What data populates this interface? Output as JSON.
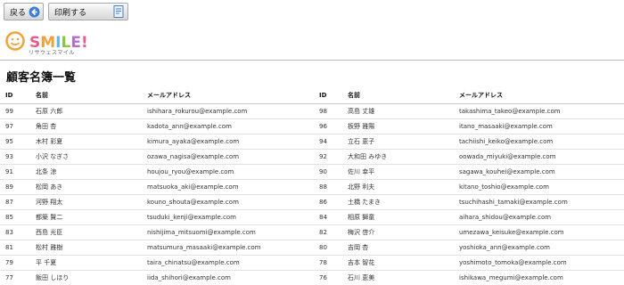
{
  "toolbar": {
    "back_label": "戻る",
    "print_label": "印刷する"
  },
  "logo": {
    "text": "SMILE!",
    "subtitle": "リサウェスマイル",
    "face_color": "#f2a23a",
    "letter_colors": [
      "#e85b8a",
      "#f2a23a",
      "#5bb8e8",
      "#8cc63f",
      "#b36fd1",
      "#e85b8a"
    ]
  },
  "page": {
    "title": "顧客名簿一覧"
  },
  "table": {
    "headers": {
      "id": "ID",
      "name": "名前",
      "email": "メールアドレス"
    },
    "left_rows": [
      {
        "id": "99",
        "name": "石原 六郎",
        "email": "ishihara_rokurou@example.com"
      },
      {
        "id": "97",
        "name": "角田 杏",
        "email": "kadota_ann@example.com"
      },
      {
        "id": "95",
        "name": "木村 彩夏",
        "email": "kimura_ayaka@example.com"
      },
      {
        "id": "93",
        "name": "小沢 なぎさ",
        "email": "ozawa_nagisa@example.com"
      },
      {
        "id": "91",
        "name": "北条 涼",
        "email": "houjou_ryou@example.com"
      },
      {
        "id": "89",
        "name": "松岡 あき",
        "email": "matsuoka_aki@example.com"
      },
      {
        "id": "87",
        "name": "河野 翔太",
        "email": "kouno_shouta@example.com"
      },
      {
        "id": "85",
        "name": "都築 賢二",
        "email": "tsuduki_kenji@example.com"
      },
      {
        "id": "83",
        "name": "西島 光臣",
        "email": "nishijima_mitsuomi@example.com"
      },
      {
        "id": "81",
        "name": "松村 雅樹",
        "email": "matsumura_masaaki@example.com"
      },
      {
        "id": "79",
        "name": "平 千夏",
        "email": "taira_chinatsu@example.com"
      },
      {
        "id": "77",
        "name": "飯田 しほり",
        "email": "iida_shihori@example.com"
      }
    ],
    "right_rows": [
      {
        "id": "98",
        "name": "高島 丈雄",
        "email": "takashima_takeo@example.com"
      },
      {
        "id": "96",
        "name": "板野 雅陽",
        "email": "itano_masaaki@example.com"
      },
      {
        "id": "94",
        "name": "立石 恵子",
        "email": "tachiishi_keiko@example.com"
      },
      {
        "id": "92",
        "name": "大和田 みゆき",
        "email": "oowada_miyuki@example.com"
      },
      {
        "id": "90",
        "name": "佐川 幸平",
        "email": "sagawa_kouhei@example.com"
      },
      {
        "id": "88",
        "name": "北野 利夫",
        "email": "kitano_toshio@example.com"
      },
      {
        "id": "86",
        "name": "土橋 たまき",
        "email": "tsuchihashi_tamaki@example.com"
      },
      {
        "id": "84",
        "name": "相原 獅童",
        "email": "aihara_shidou@example.com"
      },
      {
        "id": "82",
        "name": "梅沢 啓介",
        "email": "umezawa_keisuke@example.com"
      },
      {
        "id": "80",
        "name": "吉岡 杏",
        "email": "yoshioka_ann@example.com"
      },
      {
        "id": "78",
        "name": "吉本 智花",
        "email": "yoshimoto_tomoka@example.com"
      },
      {
        "id": "76",
        "name": "石川 恵美",
        "email": "ishikawa_megumi@example.com"
      }
    ]
  }
}
